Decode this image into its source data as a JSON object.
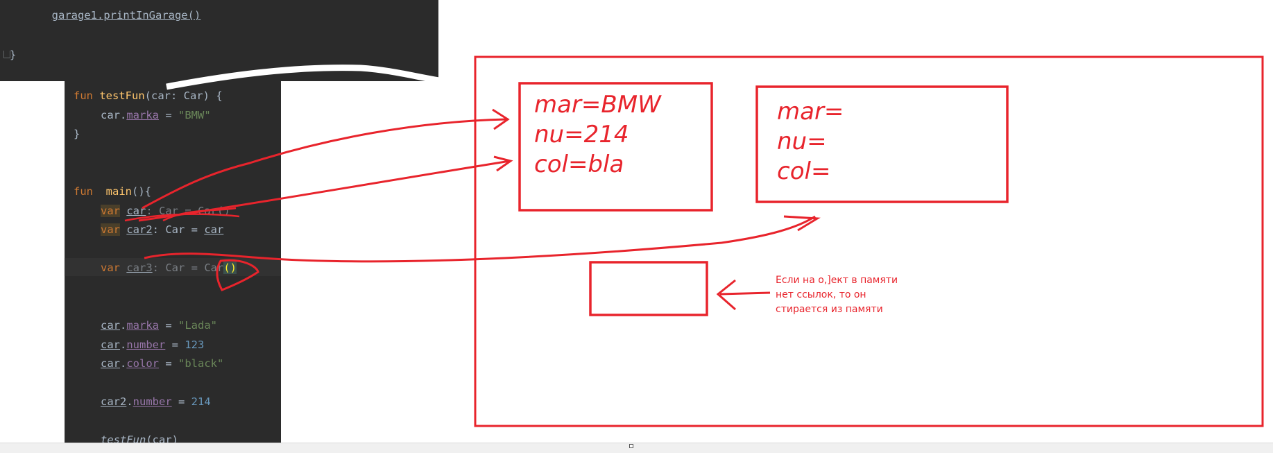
{
  "editor": {
    "top_lines": [
      {
        "cut_text": "garage1.printInGarage()"
      },
      {
        "brace": "}"
      }
    ],
    "lines": [
      {
        "kw": "fun",
        "fn": "testFun",
        "a": "(car: Car) {"
      },
      {
        "var": "car",
        "dot": ".",
        "prop": "marka",
        "eq": " = ",
        "str": "\"BMW\""
      },
      {
        "brace": "}"
      },
      {
        "kw": "fun",
        "fn": "main",
        "a": "(){"
      },
      {
        "kw": "var",
        "var": "car",
        "rest": ": Car = Car()"
      },
      {
        "kw": "var",
        "var": "car2",
        "rest": ": Car = ",
        "ref": "car"
      },
      {
        "kw": "var",
        "var": "car3",
        "rest": ": Car = Car",
        "paren": "()"
      },
      {
        "var": "car",
        "dot": ".",
        "prop": "marka",
        "eq": " = ",
        "str": "\"Lada\""
      },
      {
        "var": "car",
        "dot": ".",
        "prop": "number",
        "eq": " = ",
        "num": "123"
      },
      {
        "var": "car",
        "dot": ".",
        "prop": "color",
        "eq": " = ",
        "str": "\"black\""
      },
      {
        "var": "car2",
        "dot": ".",
        "prop": "number",
        "eq": " = ",
        "num": "214"
      },
      {
        "fn": "testFun",
        "a": "(car)"
      }
    ]
  },
  "drawing": {
    "ink_color": "#e8242c",
    "box1": {
      "line1": "mar=BMW",
      "line2": "nu=214",
      "line3": "col=bla"
    },
    "box2": {
      "line1": "mar=",
      "line2": "nu=",
      "line3": "col="
    },
    "note": {
      "line1": "Если на о,]ект в памяти",
      "line2": "нет ссылок, то он",
      "line3": "стирается из памяти"
    }
  }
}
